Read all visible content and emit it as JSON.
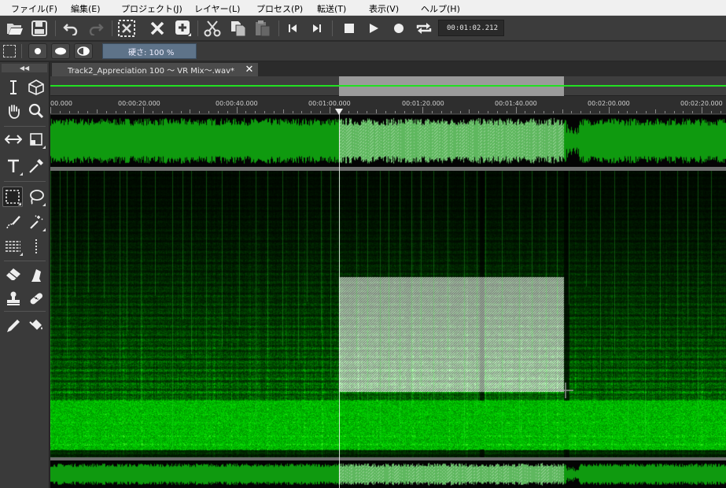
{
  "menu": {
    "items": [
      {
        "label": "ファイル(F)"
      },
      {
        "label": "編集(E)"
      },
      {
        "label": "プロジェクト(J)"
      },
      {
        "label": "レイヤー(L)"
      },
      {
        "label": "プロセス(P)"
      },
      {
        "label": "転送(T)"
      },
      {
        "label": "表示(V)"
      },
      {
        "label": "ヘルプ(H)"
      }
    ]
  },
  "toolbar": {
    "time_display": "00:01:02.212"
  },
  "brush": {
    "hardness_label": "硬さ: 100 %"
  },
  "file_tab": {
    "title": "Track2_Appreciation 100 〜 VR Mix〜.wav*",
    "close_glyph": "✕"
  },
  "ruler": {
    "labels": [
      "00.000",
      "00:00:20.000",
      "00:00:40.000",
      "00:01:00.000",
      "00:01:20.000",
      "00:01:40.000",
      "00:02:00.000",
      "00:02:20.000"
    ]
  },
  "colors": {
    "waveform": "#0f9a0f",
    "spectrogram": "#12e012",
    "selection": "#d8ecd8",
    "overview_line": "#22e022"
  },
  "selection": {
    "start": "00:01:02.212",
    "end_approx": "00:01:50.000"
  }
}
